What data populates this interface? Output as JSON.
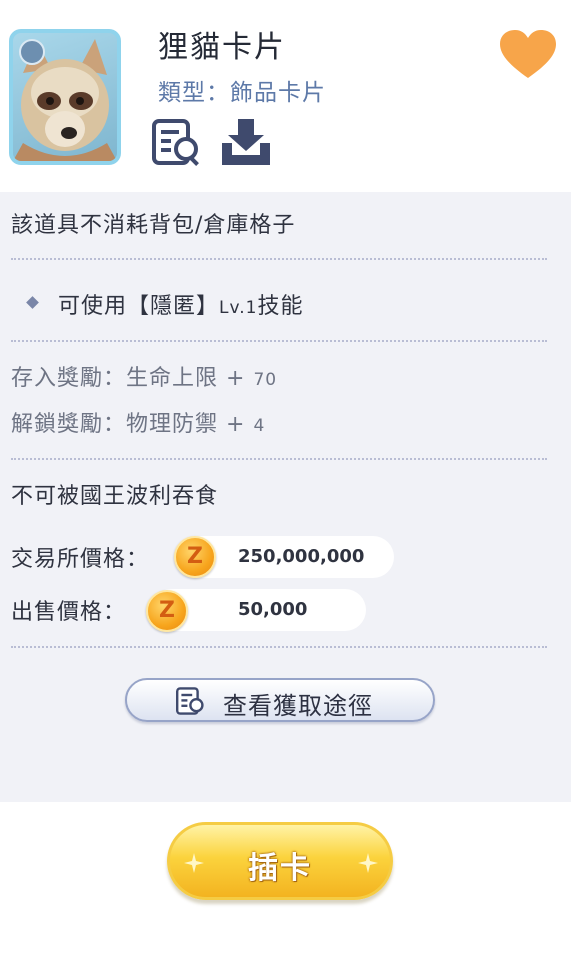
{
  "card": {
    "title": "狸貓卡片",
    "type_label": "類型：飾品卡片"
  },
  "icons": {
    "info": "info-search-icon",
    "download": "download-tray-icon",
    "favorite": "heart-icon",
    "coin": "zeny-coin-icon",
    "route": "info-search-icon"
  },
  "details": {
    "storage_note": "該道具不消耗背包/倉庫格子",
    "skill_prefix": "可使用【隱匿】",
    "skill_level": "Lv.1",
    "skill_suffix": "技能",
    "deposit_label": "存入獎勵：生命上限 +",
    "deposit_value": "70",
    "unlock_label": "解鎖獎勵：物理防禦 +",
    "unlock_value": "4",
    "poring_note": "不可被國王波利吞食",
    "exchange_label": "交易所價格：",
    "exchange_price": "250,000,000",
    "sell_label": "出售價格：",
    "sell_price": "50,000"
  },
  "buttons": {
    "view_route": "查看獲取途徑",
    "insert_card": "插卡"
  },
  "colors": {
    "accent_blue": "#5d79a8",
    "heart": "#f7a54a",
    "coin": "#f7a51d",
    "insert_button": "#fbd33d"
  }
}
